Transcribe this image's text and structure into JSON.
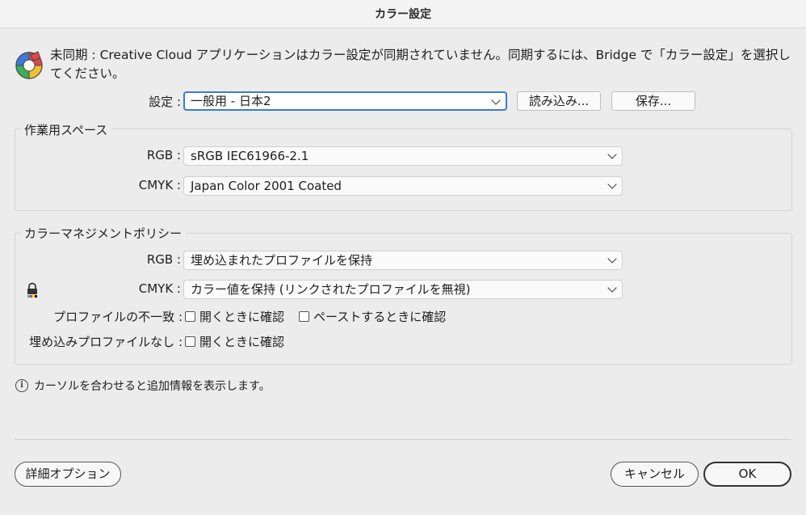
{
  "window": {
    "title": "カラー設定"
  },
  "sync": {
    "message": "未同期 : Creative Cloud アプリケーションはカラー設定が同期されていません。同期するには、Bridge で「カラー設定」を選択してください。",
    "icon": "color-wheel-icon"
  },
  "settings": {
    "label": "設定 :",
    "value": "一般用 - 日本2",
    "load_button": "読み込み...",
    "save_button": "保存..."
  },
  "working_spaces": {
    "title": "作業用スペース",
    "rgb_label": "RGB :",
    "rgb_value": "sRGB IEC61966-2.1",
    "cmyk_label": "CMYK :",
    "cmyk_value": "Japan Color 2001 Coated"
  },
  "color_management": {
    "title": "カラーマネジメントポリシー",
    "rgb_label": "RGB :",
    "rgb_value": "埋め込まれたプロファイルを保持",
    "cmyk_label": "CMYK :",
    "cmyk_value": "カラー値を保持 (リンクされたプロファイルを無視)",
    "mismatch_label": "プロファイルの不一致 :",
    "mismatch_open_check": "開くときに確認",
    "mismatch_paste_check": "ペーストするときに確認",
    "missing_label": "埋め込みプロファイルなし :",
    "missing_open_check": "開くときに確認",
    "checks": {
      "mismatch_open": false,
      "mismatch_paste": false,
      "missing_open": false
    }
  },
  "info": {
    "text": "カーソルを合わせると追加情報を表示します。"
  },
  "footer": {
    "advanced_button": "詳細オプション",
    "cancel_button": "キャンセル",
    "ok_button": "OK"
  }
}
